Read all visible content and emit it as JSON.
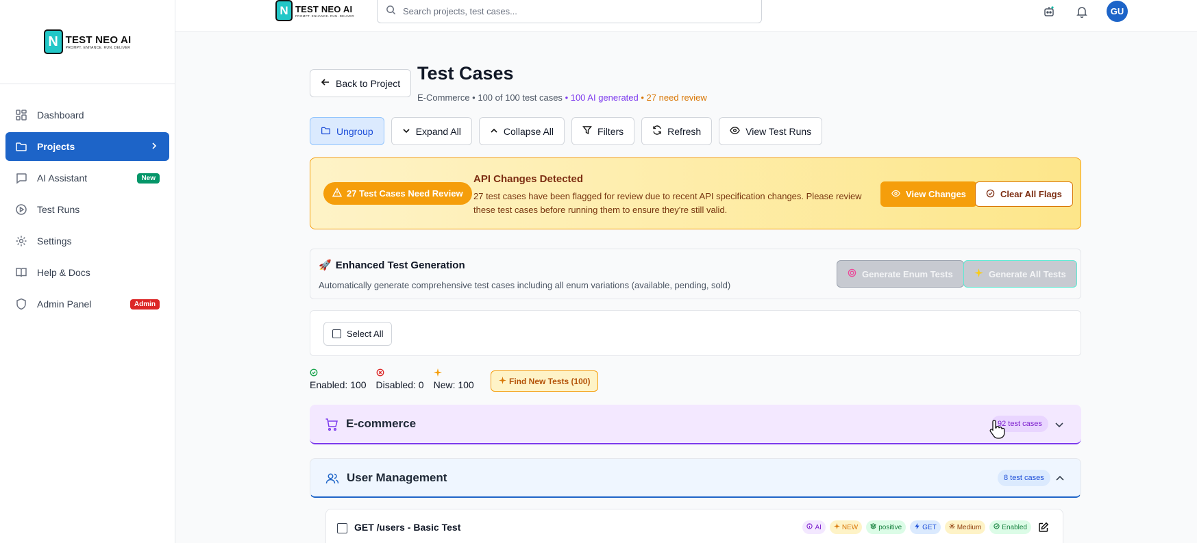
{
  "brand": {
    "name": "TEST NEO AI",
    "tagline": "PROMPT. ENHANCE. RUN. DELIVER",
    "letter": "N"
  },
  "sidebar": {
    "items": [
      {
        "label": "Dashboard",
        "icon": "grid-icon"
      },
      {
        "label": "Projects",
        "icon": "folder-icon",
        "active": true
      },
      {
        "label": "AI Assistant",
        "icon": "chat-icon",
        "badge": "New"
      },
      {
        "label": "Test Runs",
        "icon": "play-icon"
      },
      {
        "label": "Settings",
        "icon": "gear-icon"
      },
      {
        "label": "Help & Docs",
        "icon": "book-icon"
      },
      {
        "label": "Admin Panel",
        "icon": "shield-icon",
        "badge": "Admin"
      }
    ]
  },
  "topbar": {
    "search_placeholder": "Search projects, test cases...",
    "avatar_initials": "GU"
  },
  "page": {
    "back_label": "Back to Project",
    "title": "Test Cases",
    "subtitle_prefix": "E-Commerce • 100 of 100 test cases",
    "subtitle_ai": "• 100 AI generated",
    "subtitle_review": "• 27 need review"
  },
  "toolbar": {
    "ungroup": "Ungroup",
    "expand_all": "Expand All",
    "collapse_all": "Collapse All",
    "filters": "Filters",
    "refresh": "Refresh",
    "view_test_runs": "View Test Runs"
  },
  "alert": {
    "pill": "27 Test Cases Need Review",
    "title": "API Changes Detected",
    "text": "27 test cases have been flagged for review due to recent API specification changes. Please review these test cases before running them to ensure they're still valid.",
    "view_changes": "View Changes",
    "clear_flags": "Clear All Flags"
  },
  "generation": {
    "title": "Enhanced Test Generation",
    "description": "Automatically generate comprehensive test cases including all enum variations (available, pending, sold)",
    "enum_button": "Generate Enum Tests",
    "all_button": "Generate All Tests"
  },
  "selection": {
    "select_all": "Select All"
  },
  "stats": {
    "enabled": "Enabled: 100",
    "disabled": "Disabled: 0",
    "new": "New: 100",
    "find_new": "Find New Tests (100)"
  },
  "groups": [
    {
      "name": "E-commerce",
      "count": "92 test cases",
      "expanded": false
    },
    {
      "name": "User Management",
      "count": "8 test cases",
      "expanded": true
    }
  ],
  "test_case": {
    "name": "GET /users - Basic Test",
    "tags": [
      "AI",
      "NEW",
      "positive",
      "GET",
      "Medium",
      "Enabled"
    ]
  },
  "colors": {
    "primary": "#1d64c8",
    "warning": "#f59e0b",
    "purple": "#7c3aed"
  }
}
